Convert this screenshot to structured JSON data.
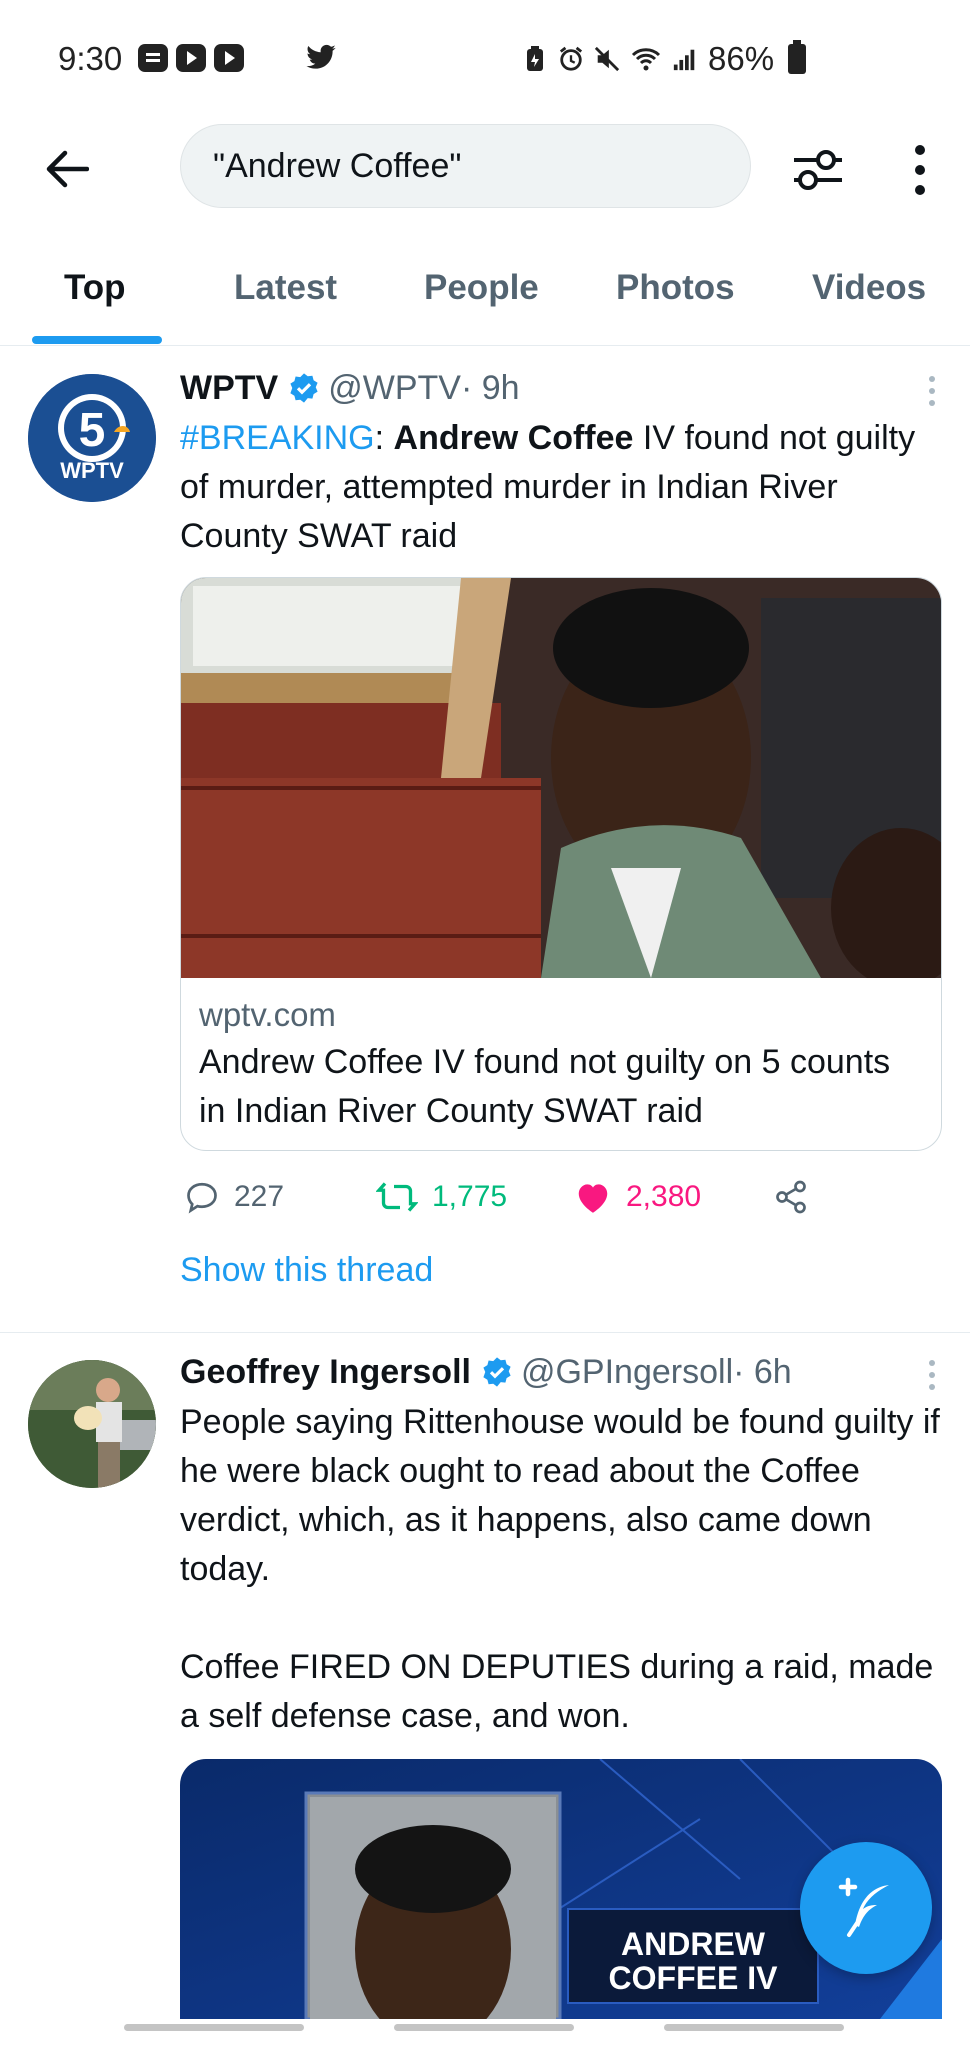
{
  "status_bar": {
    "time": "9:30",
    "battery": "86%",
    "left_icons": [
      "notes-icon",
      "youtube-icon",
      "youtube-icon",
      "twitter-icon"
    ],
    "right_icons": [
      "battery-saver-icon",
      "alarm-icon",
      "mute-icon",
      "wifi-icon",
      "signal-icon",
      "battery-icon"
    ]
  },
  "header": {
    "search_query": "\"Andrew Coffee\""
  },
  "tabs": [
    {
      "label": "Top",
      "active": true
    },
    {
      "label": "Latest",
      "active": false
    },
    {
      "label": "People",
      "active": false
    },
    {
      "label": "Photos",
      "active": false
    },
    {
      "label": "Videos",
      "active": false
    }
  ],
  "tweets": [
    {
      "name": "WPTV",
      "handle": "@WPTV",
      "time": " · 9h",
      "avatar_text": "WPTV",
      "text_tag": "#BREAKING",
      "text_colon": ": ",
      "text_bold": "Andrew Coffee",
      "text_rest": " IV found not guilty of murder, attempted murder in Indian River County SWAT raid",
      "card": {
        "domain": "wptv.com",
        "title": "Andrew Coffee IV found not guilty on 5 counts in Indian River County SWAT raid"
      },
      "replies": "227",
      "retweets": "1,775",
      "likes": "2,380",
      "show_thread": "Show this thread"
    },
    {
      "name": "Geoffrey Ingersoll",
      "handle": "@GPIngersoll",
      "time": " · 6h",
      "paragraph1": "People saying Rittenhouse would be found guilty if he were black ought to read about the Coffee verdict, which, as it happens, also came down today.",
      "paragraph2": "Coffee FIRED ON DEPUTIES during a raid, made a self defense case, and won.",
      "image_caption_line1": "ANDREW",
      "image_caption_line2": "COFFEE IV"
    }
  ],
  "colors": {
    "accent": "#1d9bf0",
    "retweet": "#00ba7c",
    "like": "#f91880",
    "secondary_text": "#536471"
  }
}
